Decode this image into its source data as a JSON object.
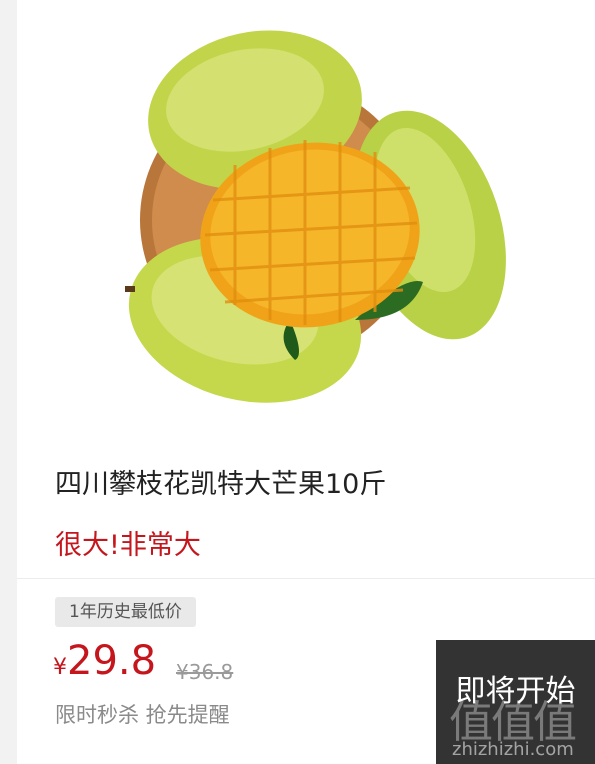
{
  "product": {
    "title": "四川攀枝花凯特大芒果10斤",
    "subtitle": "很大!非常大",
    "badge": "1年历史最低价",
    "currency": "¥",
    "price": "29.8",
    "original_price": "¥36.8",
    "promo_text": "限时秒杀 抢先提醒",
    "image_icon": "mango-product-image"
  },
  "cta": {
    "label": "即将开始"
  },
  "watermark": {
    "glyph": "值值值",
    "url": "zhizhizhi.com"
  },
  "colors": {
    "accent": "#c4161c",
    "cta_bg": "#333333",
    "badge_bg": "#e9e9e9"
  }
}
